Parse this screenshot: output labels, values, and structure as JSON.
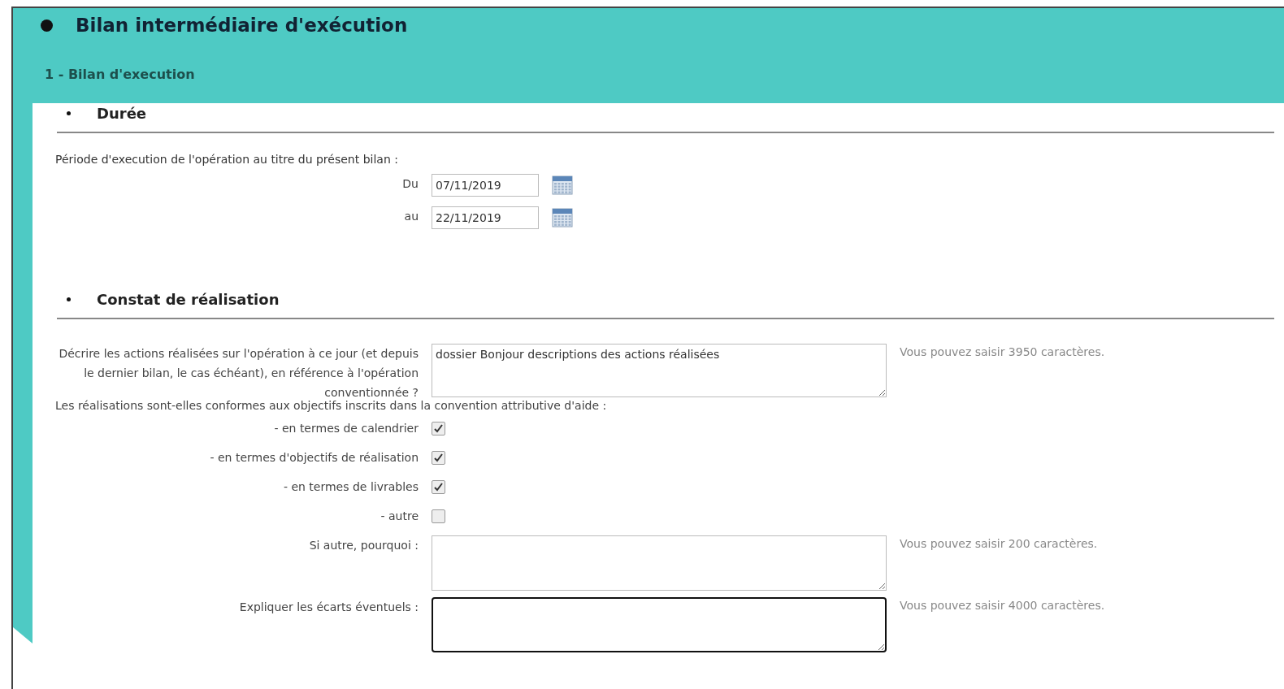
{
  "header": {
    "title": "Bilan intermédiaire d'exécution",
    "section": "1 - Bilan d'execution"
  },
  "duree": {
    "heading": "Durée",
    "period_label": "Période d'execution de l'opération au titre du présent bilan :",
    "dates": [
      {
        "label": "Du",
        "value": "07/11/2019"
      },
      {
        "label": "au",
        "value": "22/11/2019"
      }
    ]
  },
  "constat": {
    "heading": "Constat de réalisation",
    "rows": [
      {
        "kind": "textarea",
        "label": "Décrire les actions réalisées sur l'opération à ce jour (et depuis le dernier bilan, le cas échéant), en référence à l'opération conventionnée ?",
        "value": "dossier Bonjour descriptions des actions réalisées",
        "hint": "Vous pouvez saisir 3950 caractères.",
        "focused": false
      },
      {
        "kind": "note",
        "text": "Les réalisations sont-elles conformes aux objectifs inscrits dans la convention attributive d'aide :"
      },
      {
        "kind": "checkbox",
        "label": "- en termes de calendrier",
        "checked": true
      },
      {
        "kind": "checkbox",
        "label": "- en termes d'objectifs de réalisation",
        "checked": true
      },
      {
        "kind": "checkbox",
        "label": "- en termes de livrables",
        "checked": true
      },
      {
        "kind": "checkbox",
        "label": "- autre",
        "checked": false
      },
      {
        "kind": "textarea",
        "label": "Si autre, pourquoi :",
        "value": "",
        "hint": "Vous pouvez saisir 200 caractères.",
        "focused": false
      },
      {
        "kind": "textarea",
        "label": "Expliquer les écarts éventuels :",
        "value": "",
        "hint": "Vous pouvez saisir 4000 caractères.",
        "focused": true
      }
    ]
  }
}
